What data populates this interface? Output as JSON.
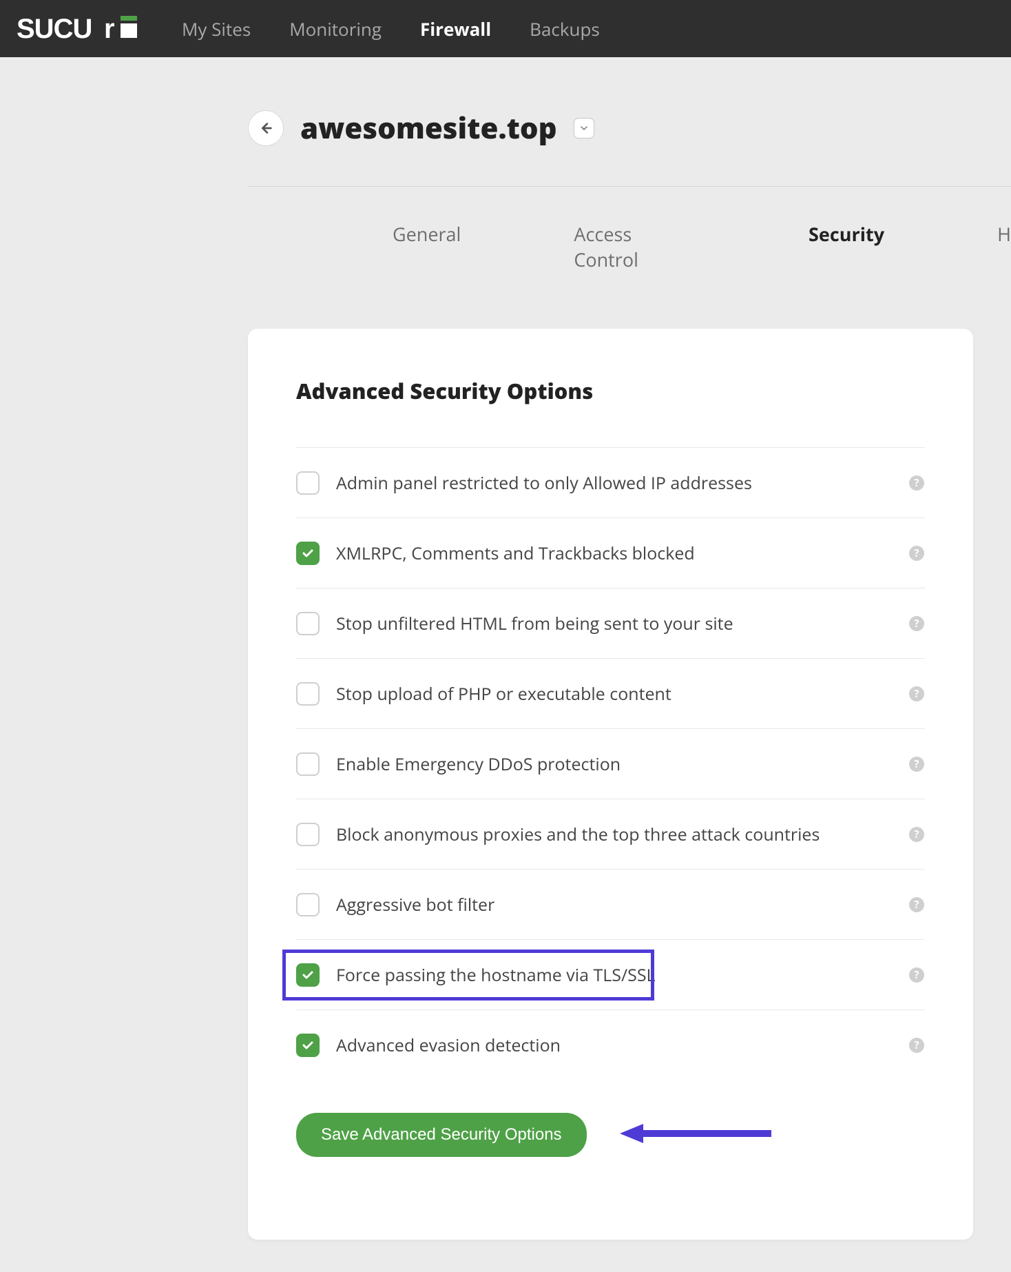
{
  "brand": "SUCURI",
  "nav": {
    "items": [
      {
        "label": "My Sites",
        "active": false
      },
      {
        "label": "Monitoring",
        "active": false
      },
      {
        "label": "Firewall",
        "active": true
      },
      {
        "label": "Backups",
        "active": false
      }
    ]
  },
  "page": {
    "site_name": "awesomesite.top"
  },
  "subtabs": [
    {
      "label": "General",
      "active": false
    },
    {
      "label": "Access Control",
      "active": false
    },
    {
      "label": "Security",
      "active": true
    },
    {
      "label": "H",
      "active": false
    }
  ],
  "card": {
    "title": "Advanced Security Options",
    "options": [
      {
        "label": "Admin panel restricted to only Allowed IP addresses",
        "checked": false
      },
      {
        "label": "XMLRPC, Comments and Trackbacks blocked",
        "checked": true
      },
      {
        "label": "Stop unfiltered HTML from being sent to your site",
        "checked": false
      },
      {
        "label": "Stop upload of PHP or executable content",
        "checked": false
      },
      {
        "label": "Enable Emergency DDoS protection",
        "checked": false
      },
      {
        "label": "Block anonymous proxies and the top three attack countries",
        "checked": false
      },
      {
        "label": "Aggressive bot filter",
        "checked": false
      },
      {
        "label": "Force passing the hostname via TLS/SSL",
        "checked": true
      },
      {
        "label": "Advanced evasion detection",
        "checked": true
      }
    ],
    "save_label": "Save Advanced Security Options"
  },
  "annotation": {
    "highlight_option_index": 7,
    "highlight_color": "#4e3bd6"
  }
}
